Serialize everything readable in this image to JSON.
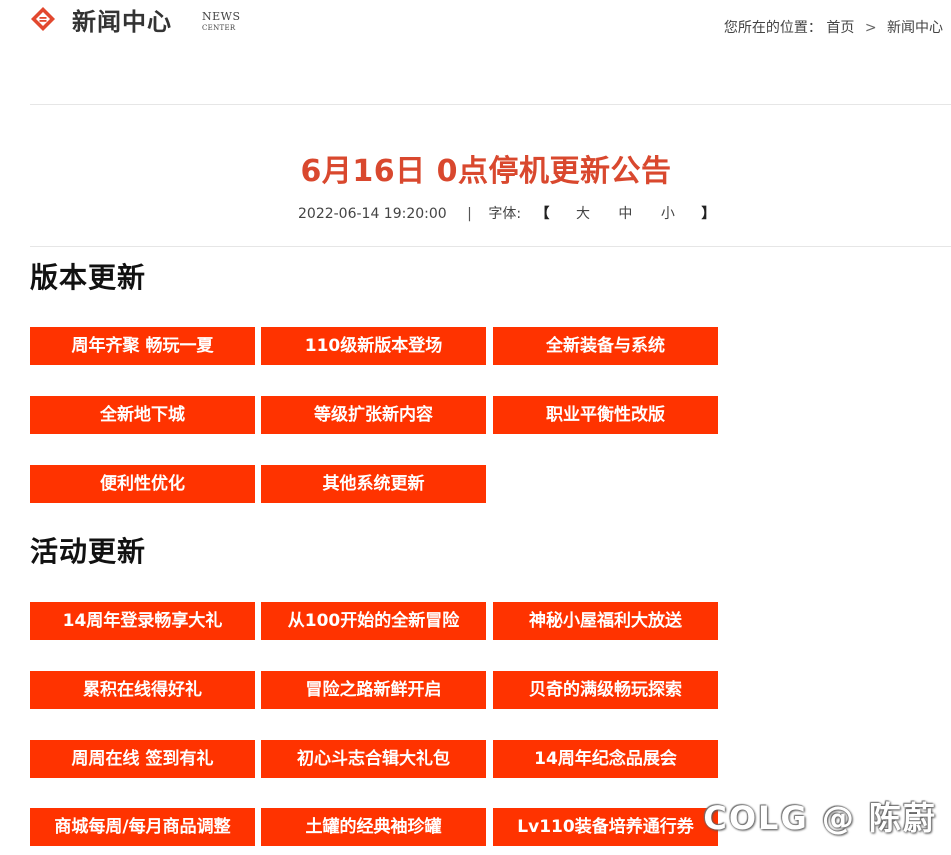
{
  "header": {
    "logo_icon": "diamond-logo-icon",
    "site_title": "新闻中心",
    "news_en_line1": "NEWS",
    "news_en_line2": "CENTER",
    "breadcrumb": {
      "prefix": "您所在的位置：",
      "home": "首页",
      "separator": ">",
      "current": "新闻中心"
    }
  },
  "article": {
    "title": "6月16日 0点停机更新公告",
    "datetime": "2022-06-14 19:20:00",
    "pipe": "|",
    "font_size_label": "字体:",
    "bracket_open": "【",
    "bracket_close": "】",
    "font_sizes": [
      "大",
      "中",
      "小"
    ]
  },
  "sections": [
    {
      "heading": "版本更新",
      "buttons": [
        "周年齐聚 畅玩一夏",
        "110级新版本登场",
        "全新装备与系统",
        "全新地下城",
        "等级扩张新内容",
        "职业平衡性改版",
        "便利性优化",
        "其他系统更新"
      ]
    },
    {
      "heading": "活动更新",
      "buttons": [
        "14周年登录畅享大礼",
        "从100开始的全新冒险",
        "神秘小屋福利大放送",
        "累积在线得好礼",
        "冒险之路新鲜开启",
        "贝奇的满级畅玩探索",
        "周周在线 签到有礼",
        "初心斗志合辑大礼包",
        "14周年纪念品展会",
        "商城每周/每月商品调整",
        "土罐的经典袖珍罐",
        "Lv110装备培养通行券"
      ]
    }
  ],
  "watermark": "COLG @ 陈蔚",
  "colors": {
    "accent_title": "#d9482e",
    "button_bg": "#ff3300",
    "button_text": "#ffffff"
  }
}
